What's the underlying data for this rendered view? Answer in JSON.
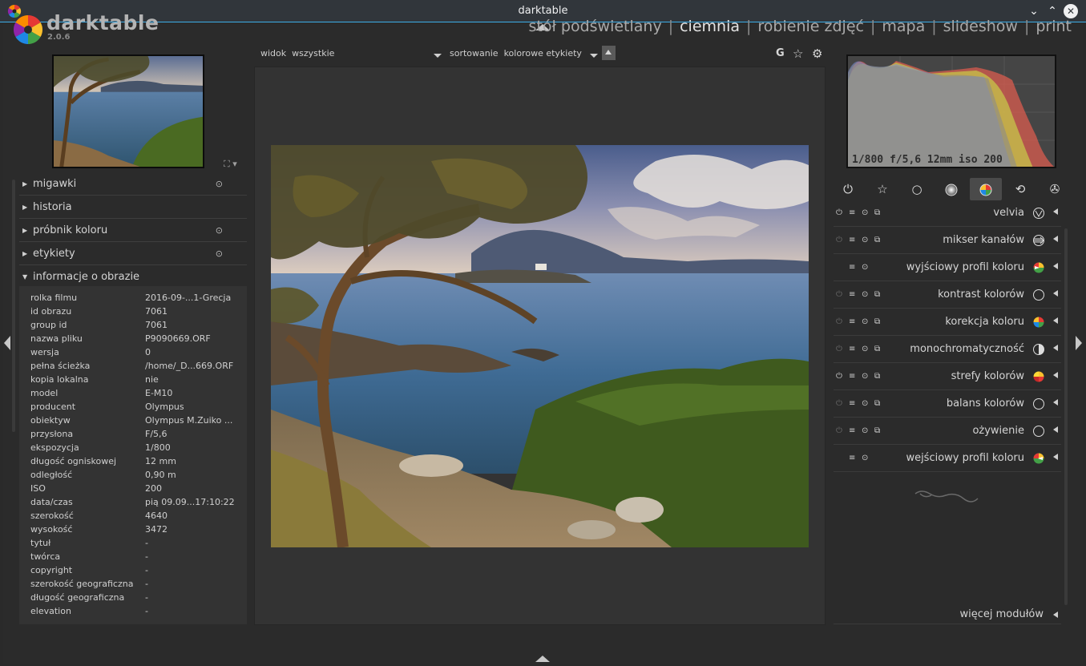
{
  "window": {
    "title": "darktable",
    "minimize_glyph": "⌄",
    "maximize_glyph": "⌃",
    "close_glyph": "✕"
  },
  "app": {
    "name": "darktable",
    "version": "2.0.6"
  },
  "views": [
    "stół podświetlany",
    "ciemnia",
    "robienie zdjęć",
    "mapa",
    "slideshow",
    "print"
  ],
  "active_view": "ciemnia",
  "view_separator": "|",
  "toolbar": {
    "view_label": "widok",
    "view_value": "wszystkie",
    "sort_label": "sortowanie",
    "sort_value": "kolorowe etykiety",
    "grouping_glyph": "G",
    "overlay_glyph": "☆",
    "prefs_glyph": "⚙"
  },
  "thumb_controls": "⛶ ▾",
  "left_modules": [
    {
      "label": "migawki",
      "has_reset": true
    },
    {
      "label": "historia",
      "has_reset": false
    },
    {
      "label": "próbnik koloru",
      "has_reset": true
    },
    {
      "label": "etykiety",
      "has_reset": true
    },
    {
      "label": "informacje o obrazie",
      "has_reset": false,
      "expanded": true
    }
  ],
  "image_info": [
    {
      "key": "rolka filmu",
      "value": " 2016-09-...1-Grecja"
    },
    {
      "key": "id obrazu",
      "value": "7061"
    },
    {
      "key": "group id",
      "value": "7061"
    },
    {
      "key": "nazwa pliku",
      "value": "P9090669.ORF"
    },
    {
      "key": "wersja",
      "value": "0"
    },
    {
      "key": "pełna ścieżka",
      "value": "/home/_D...669.ORF"
    },
    {
      "key": "kopia lokalna",
      "value": "nie"
    },
    {
      "key": "model",
      "value": "E-M10"
    },
    {
      "key": "producent",
      "value": "Olympus"
    },
    {
      "key": "obiektyw",
      "value": "Olympus M.Zuiko ..."
    },
    {
      "key": "przysłona",
      "value": "F/5,6"
    },
    {
      "key": "ekspozycja",
      "value": "1/800"
    },
    {
      "key": "długość ogniskowej",
      "value": "12 mm"
    },
    {
      "key": "odległość",
      "value": "0,90 m"
    },
    {
      "key": "ISO",
      "value": "200"
    },
    {
      "key": "data/czas",
      "value": "pią 09.09...17:10:22"
    },
    {
      "key": "szerokość",
      "value": "4640"
    },
    {
      "key": "wysokość",
      "value": "3472"
    },
    {
      "key": "tytuł",
      "value": "-"
    },
    {
      "key": "twórca",
      "value": "-"
    },
    {
      "key": "copyright",
      "value": "-"
    },
    {
      "key": "szerokość geograficzna",
      "value": "-"
    },
    {
      "key": "długość geograficzna",
      "value": "-"
    },
    {
      "key": "elevation",
      "value": "-"
    }
  ],
  "histogram_info": "1/800 f/5,6 12mm iso 200",
  "module_groups": [
    {
      "icon": "power-icon",
      "glyph": "⏻",
      "active": false
    },
    {
      "icon": "favorites-star-icon",
      "glyph": "☆",
      "active": false
    },
    {
      "icon": "basic-circle-icon",
      "glyph": "○",
      "active": false
    },
    {
      "icon": "tone-circle-icon",
      "glyph": "●",
      "active": false
    },
    {
      "icon": "color-circle-icon",
      "glyph": "●",
      "active": true
    },
    {
      "icon": "correct-arrows-icon",
      "glyph": "⟲",
      "active": false
    },
    {
      "icon": "effect-aperture-icon",
      "glyph": "✇",
      "active": false
    }
  ],
  "right_modules": [
    {
      "name": "velvia",
      "has_power": true,
      "power_on": true,
      "has_presets": true,
      "has_instances": true,
      "icon": "velvia-icon"
    },
    {
      "name": "mikser kanałów",
      "has_power": true,
      "power_on": false,
      "has_presets": true,
      "has_instances": true,
      "icon": "channel-mixer-icon"
    },
    {
      "name": "wyjściowy profil koloru",
      "has_power": false,
      "power_on": false,
      "has_presets": false,
      "has_instances": false,
      "icon": "output-profile-icon"
    },
    {
      "name": "kontrast kolorów",
      "has_power": true,
      "power_on": false,
      "has_presets": true,
      "has_instances": true,
      "icon": "circle-icon"
    },
    {
      "name": "korekcja koloru",
      "has_power": true,
      "power_on": false,
      "has_presets": true,
      "has_instances": true,
      "icon": "color-correction-icon"
    },
    {
      "name": "monochromatyczność",
      "has_power": true,
      "power_on": false,
      "has_presets": true,
      "has_instances": true,
      "icon": "half-circle-icon"
    },
    {
      "name": "strefy kolorów",
      "has_power": true,
      "power_on": true,
      "has_presets": true,
      "has_instances": true,
      "icon": "color-zones-icon"
    },
    {
      "name": "balans kolorów",
      "has_power": true,
      "power_on": false,
      "has_presets": true,
      "has_instances": true,
      "icon": "circle-icon"
    },
    {
      "name": "ożywienie",
      "has_power": true,
      "power_on": false,
      "has_presets": true,
      "has_instances": true,
      "icon": "circle-icon"
    },
    {
      "name": "wejściowy profil koloru",
      "has_power": false,
      "power_on": false,
      "has_presets": false,
      "has_instances": false,
      "icon": "input-profile-icon"
    }
  ],
  "more_modules": "więcej modułów",
  "module_glyphs": {
    "power": "⏻",
    "presets": "≡",
    "reset": "⊙",
    "instances": "⧉"
  }
}
